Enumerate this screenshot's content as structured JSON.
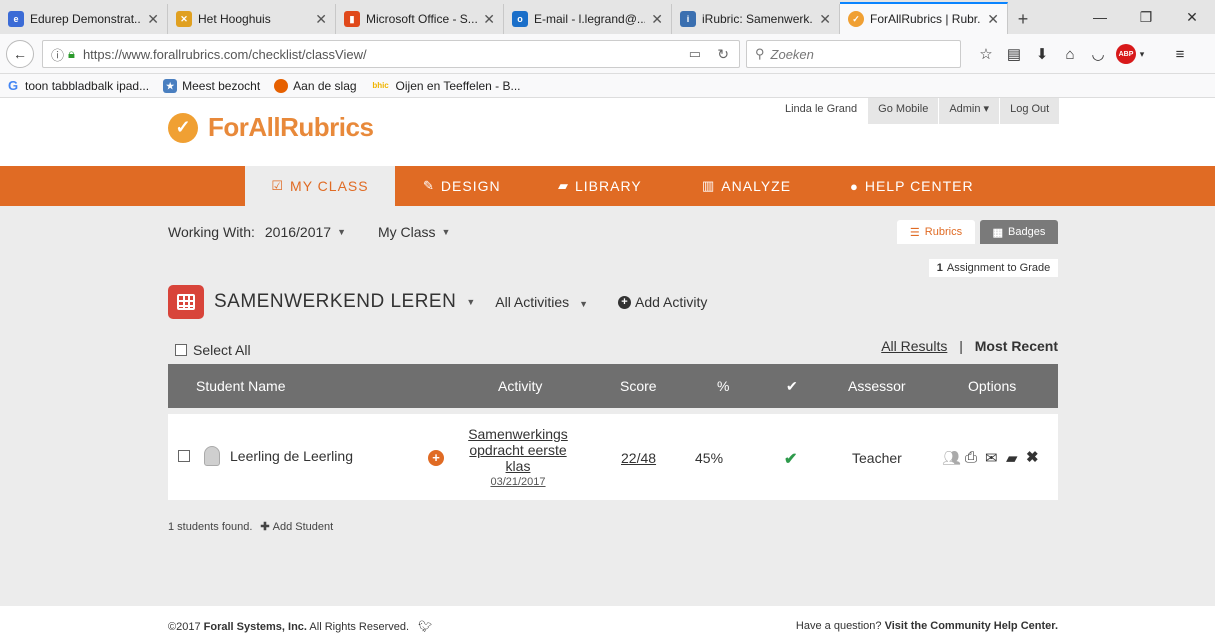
{
  "browser": {
    "tabs": [
      {
        "label": "Edurep Demonstrat...",
        "favicon": "edurep-icon",
        "color": "#3b6bd6"
      },
      {
        "label": "Het Hooghuis",
        "favicon": "hooghuis-icon",
        "color": "#e0a020"
      },
      {
        "label": "Microsoft Office - S...",
        "favicon": "office-icon",
        "color": "#e0491b"
      },
      {
        "label": "E-mail - l.legrand@...",
        "favicon": "outlook-icon",
        "color": "#1b6fc9"
      },
      {
        "label": "iRubric: Samenwerk...",
        "favicon": "irubric-icon",
        "color": "#3a6fb0"
      },
      {
        "label": "ForAllRubrics | Rubr...",
        "favicon": "forallrubrics-icon",
        "color": "#f0a033"
      }
    ],
    "new_tab": "+",
    "url": "https://www.forallrubrics.com/checklist/classView/",
    "search_placeholder": "Zoeken",
    "bookmarks": [
      {
        "label": "toon tabbladbalk ipad...",
        "icon": "google-icon",
        "color": "#4285f4",
        "glyph": "G"
      },
      {
        "label": "Meest bezocht",
        "icon": "star-folder-icon",
        "color": "#4a7fc0",
        "glyph": "★"
      },
      {
        "label": "Aan de slag",
        "icon": "firefox-icon",
        "color": "#e66000",
        "glyph": "●"
      },
      {
        "label": "Oijen en Teeffelen - B...",
        "icon": "bhic-icon",
        "color": "#f0b400",
        "glyph": "bhic"
      }
    ]
  },
  "header": {
    "logo_text_part1": "ForAll",
    "logo_text_part2": "Rubrics",
    "user_name": "Linda le Grand",
    "go_mobile": "Go Mobile",
    "admin": "Admin ▾",
    "log_out": "Log Out"
  },
  "nav": {
    "my_class": "MY CLASS",
    "design": "DESIGN",
    "library": "LIBRARY",
    "analyze": "ANALYZE",
    "help_center": "HELP CENTER"
  },
  "workbar": {
    "working_with_label": "Working With:",
    "year": "2016/2017",
    "class": "My Class"
  },
  "view_toggle": {
    "rubrics": "Rubrics",
    "badges": "Badges"
  },
  "assignment_badge": {
    "count": "1",
    "text": "Assignment to Grade"
  },
  "rubric": {
    "name": "SAMENWERKEND LEREN",
    "activities_filter": "All Activities",
    "add_activity": "Add Activity"
  },
  "list_controls": {
    "select_all": "Select All",
    "all_results": "All Results",
    "separator": "|",
    "most_recent": "Most Recent"
  },
  "table": {
    "headers": {
      "student_name": "Student Name",
      "activity": "Activity",
      "score": "Score",
      "percent": "%",
      "check": "✔",
      "assessor": "Assessor",
      "options": "Options"
    },
    "rows": [
      {
        "student": "Leerling de Leerling",
        "activity_line1": "Samenwerkings",
        "activity_line2": "opdracht eerste",
        "activity_line3": "klas",
        "date": "03/21/2017",
        "score": "22/48",
        "percent": "45%",
        "assessor": "Teacher"
      }
    ]
  },
  "footnote": {
    "found": "1 students found.",
    "add_student": "Add Student"
  },
  "footer": {
    "copyright_prefix": "©2017 ",
    "company": "Forall Systems, Inc.",
    "rights": " All Rights Reserved.",
    "question": "Have a question?",
    "community": "Visit the Community Help Center."
  },
  "colors": {
    "brand_orange": "#e06b24",
    "header_gray": "#6f6f6f",
    "check_green": "#2e9a4b",
    "rubric_red": "#d8443a"
  }
}
